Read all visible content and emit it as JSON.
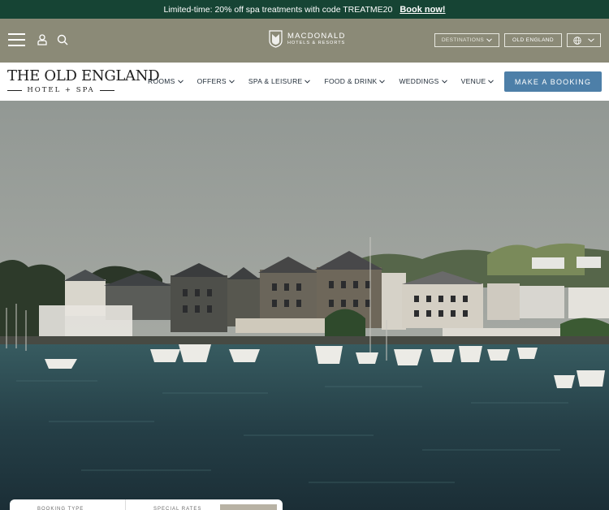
{
  "promo": {
    "text": "Limited-time: 20% off spa treatments with code TREATME20",
    "link": "Book now!"
  },
  "utility": {
    "brand_name": "MACDONALD",
    "brand_sub": "HOTELS & RESORTS",
    "destinations_label": "DESTINATIONS",
    "hotel_label": "OLD ENGLAND",
    "icons": [
      "menu-icon",
      "user-icon",
      "search-icon",
      "globe-icon",
      "chevron-down-icon"
    ]
  },
  "nav": {
    "logo_main": "THE OLD ENGLAND",
    "logo_sub": "HOTEL + SPA",
    "items": [
      {
        "label": "ROOMS"
      },
      {
        "label": "OFFERS"
      },
      {
        "label": "SPA & LEISURE"
      },
      {
        "label": "FOOD & DRINK"
      },
      {
        "label": "WEDDINGS"
      },
      {
        "label": "VENUE"
      }
    ],
    "book_label": "MAKE A BOOKING"
  },
  "booking": {
    "type_label": "BOOKING TYPE",
    "rates_label": "SPECIAL RATES"
  },
  "colors": {
    "promo_bg": "#164434",
    "utility_bg": "#8b8a77",
    "accent": "#4d7fa8"
  }
}
